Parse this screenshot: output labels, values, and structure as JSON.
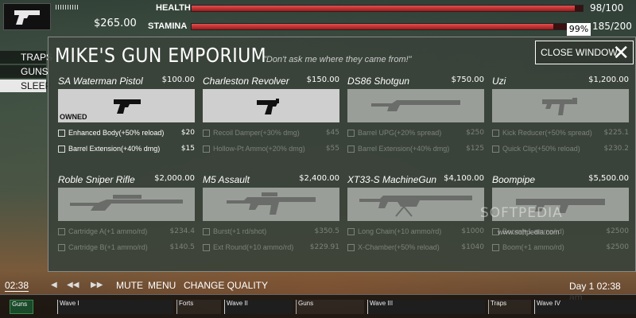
{
  "hud": {
    "money": "$265.00",
    "health_label": "HEALTH",
    "health_value": "98/100",
    "health_fraction": 0.98,
    "stamina_label": "STAMINA",
    "stamina_value": "185/200",
    "stamina_fraction": 0.925,
    "stamina_percent": "99%",
    "weapon_icon": "pistol-icon"
  },
  "side_menu": {
    "items": [
      {
        "label": "TRAPS"
      },
      {
        "label": "GUNS"
      },
      {
        "label": "SLEEP"
      }
    ]
  },
  "shop": {
    "title": "MIKE'S GUN EMPORIUM",
    "subtitle": "\"Don't ask me where they came from!\"",
    "close_label": "CLOSE WINDOW",
    "weapons": [
      {
        "name": "SA Waterman Pistol",
        "price": "$100.00",
        "status": "OWNED",
        "upgrades": [
          {
            "name": "Enhanced Body(+50% reload)",
            "price": "$20"
          },
          {
            "name": "Barrel Extension(+40% dmg)",
            "price": "$15"
          }
        ]
      },
      {
        "name": "Charleston Revolver",
        "price": "$150.00",
        "status": "",
        "upgrades": [
          {
            "name": "Recoil Damper(+30% dmg)",
            "price": "$45"
          },
          {
            "name": "Hollow-Pt Ammo(+20% dmg)",
            "price": "$55"
          }
        ]
      },
      {
        "name": "DS86 Shotgun",
        "price": "$750.00",
        "status": "",
        "upgrades": [
          {
            "name": "Barrel UPG(+20% spread)",
            "price": "$250"
          },
          {
            "name": "Barrel Extension(+40% dmg)",
            "price": "$125"
          }
        ]
      },
      {
        "name": "Uzi",
        "price": "$1,200.00",
        "status": "",
        "upgrades": [
          {
            "name": "Kick Reducer(+50% spread)",
            "price": "$225.1"
          },
          {
            "name": "Quick Clip(+50% reload)",
            "price": "$230.2"
          }
        ]
      },
      {
        "name": "Roble Sniper Rifle",
        "price": "$2,000.00",
        "status": "",
        "upgrades": [
          {
            "name": "Cartridge A(+1 ammo/rd)",
            "price": "$234.4"
          },
          {
            "name": "Cartridge B(+1 ammo/rd)",
            "price": "$140.5"
          }
        ]
      },
      {
        "name": "M5 Assault",
        "price": "$2,400.00",
        "status": "",
        "upgrades": [
          {
            "name": "Burst(+1 rd/shot)",
            "price": "$350.5"
          },
          {
            "name": "Ext Round(+10 ammo/rd)",
            "price": "$229.91"
          }
        ]
      },
      {
        "name": "XT33-S MachineGun",
        "price": "$4,100.00",
        "status": "",
        "upgrades": [
          {
            "name": "Long Chain(+10 ammo/rd)",
            "price": "$1000"
          },
          {
            "name": "X-Chamber(+50% reload)",
            "price": "$1040"
          }
        ]
      },
      {
        "name": "Boompipe",
        "price": "$5,500.00",
        "status": "",
        "upgrades": [
          {
            "name": "Boom(+1 ammo/rd)",
            "price": "$2500"
          },
          {
            "name": "Boom(+1 ammo/rd)",
            "price": "$2500"
          }
        ]
      }
    ]
  },
  "watermark": {
    "text": "SOFTPEDIA",
    "url": "www.softpedia.com"
  },
  "bottom": {
    "time": "02:38",
    "mute_label": "MUTE",
    "menu_label": "MENU",
    "quality_label": "CHANGE QUALITY",
    "day_time": "Day 1 02:38 am",
    "timeline": [
      {
        "label": "Guns",
        "kind": "guns-active"
      },
      {
        "label": "Wave I",
        "kind": "wave"
      },
      {
        "label": "Forts",
        "kind": "phase"
      },
      {
        "label": "Wave II",
        "kind": "wave"
      },
      {
        "label": "Guns",
        "kind": "phase"
      },
      {
        "label": "Wave III",
        "kind": "wave"
      },
      {
        "label": "Traps",
        "kind": "phase"
      },
      {
        "label": "Wave IV",
        "kind": "wave"
      }
    ]
  }
}
